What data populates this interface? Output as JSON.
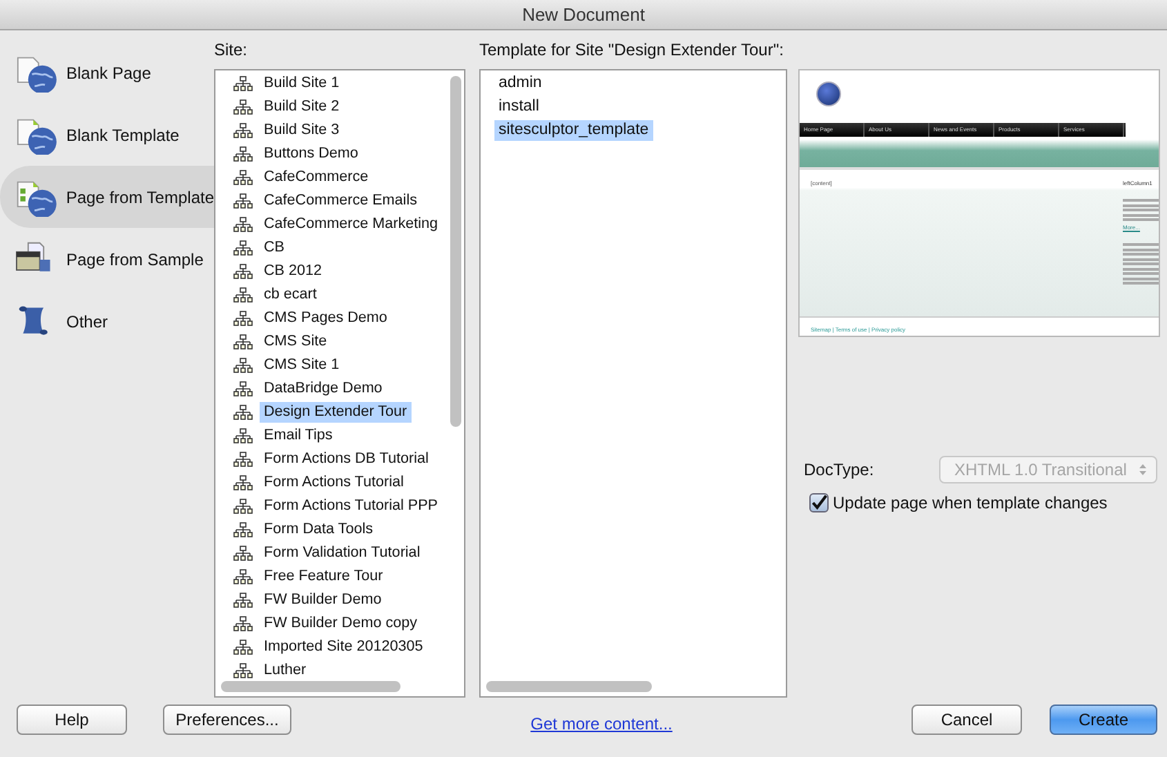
{
  "window": {
    "title": "New Document"
  },
  "categories": [
    {
      "label": "Blank Page",
      "kind": "blank-page",
      "selected": false
    },
    {
      "label": "Blank Template",
      "kind": "blank-template",
      "selected": false
    },
    {
      "label": "Page from Template",
      "kind": "page-from-template",
      "selected": true
    },
    {
      "label": "Page from Sample",
      "kind": "page-from-sample",
      "selected": false
    },
    {
      "label": "Other",
      "kind": "other",
      "selected": false
    }
  ],
  "site": {
    "label": "Site:",
    "items": [
      {
        "label": "Build Site 1",
        "selected": false
      },
      {
        "label": "Build Site 2",
        "selected": false
      },
      {
        "label": "Build Site 3",
        "selected": false
      },
      {
        "label": "Buttons Demo",
        "selected": false
      },
      {
        "label": "CafeCommerce",
        "selected": false
      },
      {
        "label": "CafeCommerce Emails",
        "selected": false
      },
      {
        "label": "CafeCommerce Marketing",
        "selected": false
      },
      {
        "label": "CB",
        "selected": false
      },
      {
        "label": "CB 2012",
        "selected": false
      },
      {
        "label": "cb ecart",
        "selected": false
      },
      {
        "label": "CMS Pages Demo",
        "selected": false
      },
      {
        "label": "CMS Site",
        "selected": false
      },
      {
        "label": "CMS Site 1",
        "selected": false
      },
      {
        "label": "DataBridge Demo",
        "selected": false
      },
      {
        "label": "Design Extender Tour",
        "selected": true
      },
      {
        "label": "Email Tips",
        "selected": false
      },
      {
        "label": "Form Actions DB Tutorial",
        "selected": false
      },
      {
        "label": "Form Actions Tutorial",
        "selected": false
      },
      {
        "label": "Form Actions Tutorial PPP",
        "selected": false
      },
      {
        "label": "Form Data Tools",
        "selected": false
      },
      {
        "label": "Form Validation Tutorial",
        "selected": false
      },
      {
        "label": "Free Feature Tour",
        "selected": false
      },
      {
        "label": "FW Builder Demo",
        "selected": false
      },
      {
        "label": "FW Builder Demo copy",
        "selected": false
      },
      {
        "label": "Imported Site 20120305",
        "selected": false
      },
      {
        "label": "Luther",
        "selected": false
      }
    ]
  },
  "template": {
    "label": "Template for Site \"Design Extender Tour\":",
    "items": [
      {
        "label": "admin",
        "selected": false
      },
      {
        "label": "install",
        "selected": false
      },
      {
        "label": "sitesculptor_template",
        "selected": true
      }
    ]
  },
  "preview": {
    "nav": [
      "Home Page",
      "About Us",
      "News and Events",
      "Products",
      "Services"
    ],
    "content_label": "[content]",
    "sidebar_heading": "leftColumn1",
    "more_link": "More...",
    "footer": "Sitemap | Terms of use | Privacy policy"
  },
  "doctype": {
    "label": "DocType:",
    "value": "XHTML 1.0 Transitional",
    "disabled": true
  },
  "update_option": {
    "label": "Update page when template changes",
    "checked": true
  },
  "buttons": {
    "help": "Help",
    "preferences": "Preferences...",
    "more_link": "Get more content...",
    "cancel": "Cancel",
    "create": "Create"
  }
}
